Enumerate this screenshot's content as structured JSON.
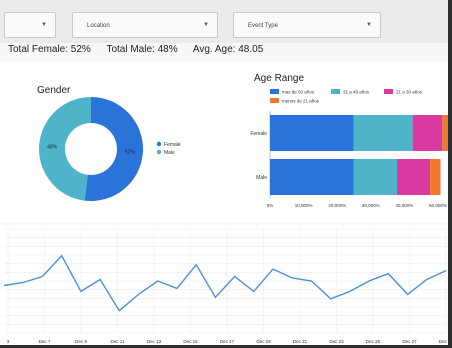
{
  "filters": [
    {
      "label": ""
    },
    {
      "label": "Location"
    },
    {
      "label": "Event Type"
    }
  ],
  "stats": {
    "female": "Total Female: 52%",
    "male": "Total Male: 48%",
    "age": "Avg. Age: 48.05"
  },
  "colors": {
    "blue": "#2a73d9",
    "teal": "#4fb3c9",
    "pink": "#d83aa0",
    "orange": "#ef7a2d"
  },
  "chart_data": [
    {
      "type": "pie",
      "title": "Gender",
      "slices": [
        {
          "name": "Female",
          "value": 52,
          "label": "52%",
          "color": "#2a73d9"
        },
        {
          "name": "Male",
          "value": 48,
          "label": "48%",
          "color": "#4fb3c9"
        }
      ],
      "legend": "right"
    },
    {
      "type": "bar",
      "orientation": "horizontal",
      "stacked": true,
      "title": "Age Range",
      "categories": [
        "Female",
        "Male"
      ],
      "series": [
        {
          "name": "mas de 50 años",
          "values": [
            48,
            48
          ],
          "color": "#2a73d9"
        },
        {
          "name": "31 a 49 años",
          "values": [
            34,
            25
          ],
          "color": "#4fb3c9"
        },
        {
          "name": "21 a 30 años",
          "values": [
            17,
            19
          ],
          "color": "#d83aa0"
        },
        {
          "name": "menos de 21 años",
          "values": [
            6,
            6
          ],
          "color": "#ef7a2d"
        }
      ],
      "xticks": [
        "0%",
        "10,000%",
        "20,000%",
        "30,000%",
        "40,000%",
        "50,000%"
      ],
      "xlim": [
        0,
        100
      ],
      "legend": "top"
    },
    {
      "type": "line",
      "x": [
        "Dec 6",
        "Dec 7",
        "Dec 8",
        "Dec 9",
        "Dec 10",
        "Dec 11",
        "Dec 12",
        "Dec 13",
        "Dec 14",
        "Dec 15",
        "Dec 16",
        "Dec 17",
        "Dec 18",
        "Dec 19",
        "Dec 20",
        "Dec 21",
        "Dec 22",
        "Dec 23",
        "Dec 24",
        "Dec 25",
        "Dec 26",
        "Dec 27",
        "Dec 28",
        "Dec 29"
      ],
      "xticks": [
        "3",
        "Dec 7",
        "Dec 9",
        "Dec 11",
        "Dec 13",
        "Dec 15",
        "Dec 17",
        "Dec 19",
        "Dec 21",
        "Dec 23",
        "Dec 25",
        "Dec 27",
        "Dec 29"
      ],
      "values": [
        52,
        54,
        58,
        72,
        48,
        56,
        35,
        46,
        55,
        50,
        66,
        44,
        58,
        48,
        63,
        57,
        55,
        43,
        48,
        55,
        60,
        46,
        56,
        62
      ],
      "ylim": [
        20,
        90
      ],
      "grid": true,
      "color": "#4f8fd9"
    }
  ]
}
